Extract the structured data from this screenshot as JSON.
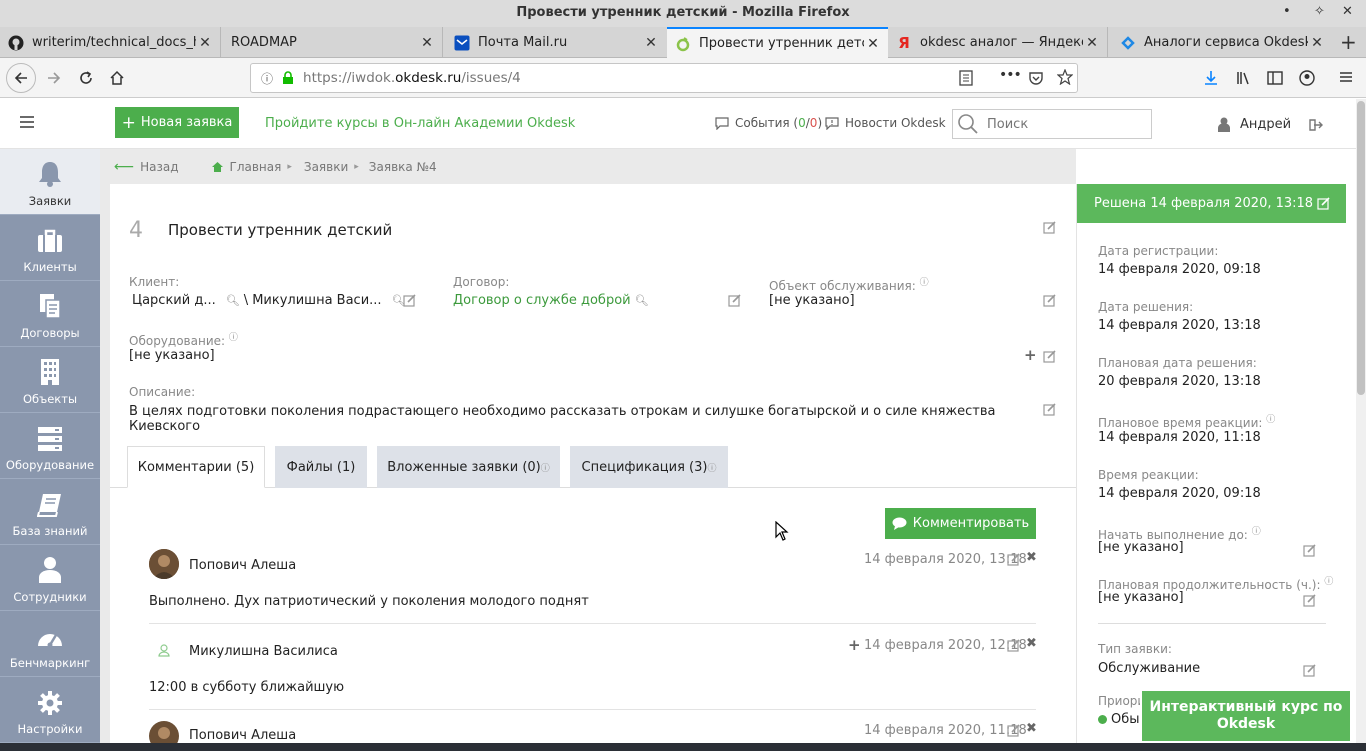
{
  "window": {
    "title": "Провести утренник детский - Mozilla Firefox"
  },
  "browser_tabs": [
    {
      "label": "writerim/technical_docs_h",
      "icon": "github-icon"
    },
    {
      "label": "ROADMAP",
      "icon": ""
    },
    {
      "label": "Почта Mail.ru",
      "icon": "mail-icon"
    },
    {
      "label": "Провести утренник детск",
      "icon": "okdesk-icon"
    },
    {
      "label": "okdesc аналог — Яндекс:",
      "icon": "yandex-icon"
    },
    {
      "label": "Аналоги сервиса Okdesk",
      "icon": "site-icon"
    }
  ],
  "address": {
    "prefix": "https://iwdok.",
    "domain": "okdesk.ru",
    "path": "/issues/4"
  },
  "header": {
    "new_ticket": "Новая заявка",
    "academy_link": "Пройдите курсы в Он-лайн Академии Okdesk",
    "events_label": "События (",
    "events_a": "0",
    "events_sep": "/",
    "events_b": "0",
    "events_close": ")",
    "news": "Новости Okdesk",
    "search_placeholder": "Поиск",
    "user": "Андрей"
  },
  "sidebar": {
    "items": [
      {
        "label": "Заявки",
        "icon": "bell-icon"
      },
      {
        "label": "Клиенты",
        "icon": "briefcase-icon"
      },
      {
        "label": "Договоры",
        "icon": "documents-icon"
      },
      {
        "label": "Объекты",
        "icon": "building-icon"
      },
      {
        "label": "Оборудование",
        "icon": "server-icon"
      },
      {
        "label": "База знаний",
        "icon": "book-icon"
      },
      {
        "label": "Сотрудники",
        "icon": "person-icon"
      },
      {
        "label": "Бенчмаркинг",
        "icon": "gauge-icon"
      },
      {
        "label": "Настройки",
        "icon": "gear-icon"
      }
    ]
  },
  "breadcrumbs": {
    "back": "Назад",
    "home": "Главная",
    "tickets": "Заявки",
    "current": "Заявка №4"
  },
  "issue": {
    "number": "4",
    "title": "Провести утренник детский",
    "client_label": "Клиент:",
    "client_company": "Царский д...",
    "client_contact": "\\ Микулишна Васи...",
    "contract_label": "Договор:",
    "contract_value": "Договор о службе доброй",
    "object_label": "Объект обслуживания:",
    "object_value": "[не указано]",
    "equipment_label": "Оборудование:",
    "equipment_value": "[не указано]",
    "description_label": "Описание:",
    "description_value": "В целях подготовки поколения подрастающего необходимо рассказать отрокам и силушке богатырской и о силе княжества Киевского"
  },
  "tabs": [
    {
      "label": "Комментарии (5)"
    },
    {
      "label": "Файлы (1)"
    },
    {
      "label": "Вложенные заявки (0)"
    },
    {
      "label": "Спецификация (3)"
    }
  ],
  "comment_button": "Комментировать",
  "comments": [
    {
      "author": "Попович Алеша",
      "date": "14 февраля 2020, 13:18",
      "text": "Выполнено. Дух патриотический у поколения молодого поднят"
    },
    {
      "author": "Микулишна Василиса",
      "date": "14 февраля 2020, 12:18",
      "text": "12:00 в субботу ближайшую"
    },
    {
      "author": "Попович Алеша",
      "date": "14 февраля 2020, 11:18",
      "text": ""
    }
  ],
  "right_panel": {
    "status": "Решена 14 февраля 2020, 13:18",
    "fields": [
      {
        "label": "Дата регистрации:",
        "value": "14 февраля 2020, 09:18"
      },
      {
        "label": "Дата решения:",
        "value": "14 февраля 2020, 13:18"
      },
      {
        "label": "Плановая дата решения:",
        "value": "20 февраля 2020, 13:18"
      },
      {
        "label": "Плановое время реакции:",
        "value": "14 февраля 2020, 11:18"
      },
      {
        "label": "Время реакции:",
        "value": "14 февраля 2020, 09:18"
      },
      {
        "label": "Начать выполнение до:",
        "value": "[не указано]"
      },
      {
        "label": "Плановая продолжительность (ч.):",
        "value": "[не указано]"
      },
      {
        "label": "Тип заявки:",
        "value": "Обслуживание"
      },
      {
        "label": "Приори",
        "value": "Обы"
      }
    ]
  },
  "course_banner": "Интерактивный курс по Okdesk",
  "colors": {
    "accent_green": "#4cae4c",
    "sidebar": "#8a97ad",
    "status_green": "#5cb85c"
  }
}
